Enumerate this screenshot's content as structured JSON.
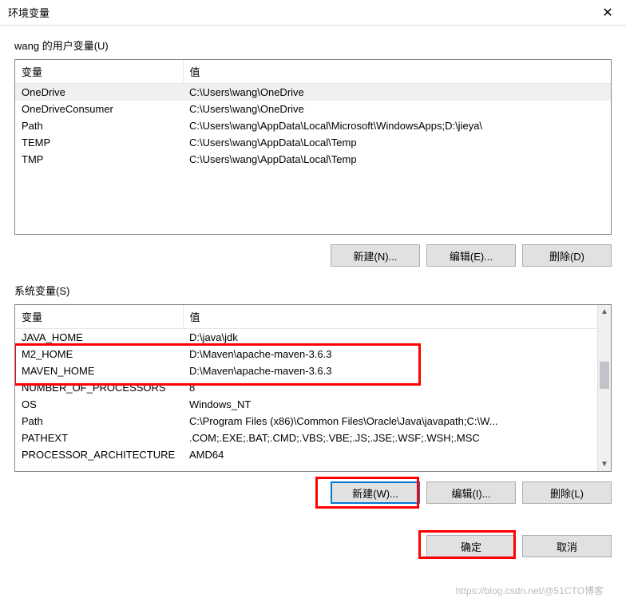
{
  "title": "环境变量",
  "close_symbol": "✕",
  "user_section": {
    "label": "wang 的用户变量(U)",
    "columns": {
      "var": "变量",
      "val": "值"
    },
    "rows": [
      {
        "var": "OneDrive",
        "val": "C:\\Users\\wang\\OneDrive",
        "selected": true
      },
      {
        "var": "OneDriveConsumer",
        "val": "C:\\Users\\wang\\OneDrive"
      },
      {
        "var": "Path",
        "val": "C:\\Users\\wang\\AppData\\Local\\Microsoft\\WindowsApps;D:\\jieya\\"
      },
      {
        "var": "TEMP",
        "val": "C:\\Users\\wang\\AppData\\Local\\Temp"
      },
      {
        "var": "TMP",
        "val": "C:\\Users\\wang\\AppData\\Local\\Temp"
      }
    ],
    "buttons": {
      "new": "新建(N)...",
      "edit": "编辑(E)...",
      "del": "删除(D)"
    }
  },
  "sys_section": {
    "label": "系统变量(S)",
    "columns": {
      "var": "变量",
      "val": "值"
    },
    "rows": [
      {
        "var": "JAVA_HOME",
        "val": "D:\\java\\jdk"
      },
      {
        "var": "M2_HOME",
        "val": "D:\\Maven\\apache-maven-3.6.3",
        "hl": true
      },
      {
        "var": "MAVEN_HOME",
        "val": "D:\\Maven\\apache-maven-3.6.3",
        "hl": true
      },
      {
        "var": "NUMBER_OF_PROCESSORS",
        "val": "8"
      },
      {
        "var": "OS",
        "val": "Windows_NT"
      },
      {
        "var": "Path",
        "val": "C:\\Program Files (x86)\\Common Files\\Oracle\\Java\\javapath;C:\\W..."
      },
      {
        "var": "PATHEXT",
        "val": ".COM;.EXE;.BAT;.CMD;.VBS;.VBE;.JS;.JSE;.WSF;.WSH;.MSC"
      },
      {
        "var": "PROCESSOR_ARCHITECTURE",
        "val": "AMD64",
        "cut": true
      }
    ],
    "buttons": {
      "new": "新建(W)...",
      "edit": "编辑(I)...",
      "del": "删除(L)"
    }
  },
  "footer": {
    "ok": "确定",
    "cancel": "取消"
  },
  "watermark": "https://blog.csdn.net/@51CTO博客"
}
